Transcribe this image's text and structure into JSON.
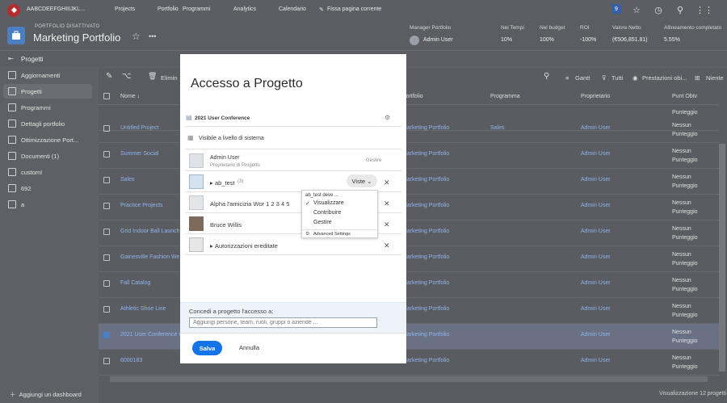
{
  "topbar": {
    "org": "AABCDEEFGHIIIJKL...",
    "nav": [
      "Projects",
      "Portfolio",
      "Programmi",
      "Analytics",
      "Calendario"
    ],
    "pin": "Fissa pagina corrente",
    "badge": "9"
  },
  "header": {
    "subtitle": "PORTFOLIO DISATTIVATO",
    "title": "Marketing Portfolio",
    "stats": [
      {
        "label": "Manager Portfolio",
        "value": "Admin User"
      },
      {
        "label": "Nei Tempi",
        "value": "10%"
      },
      {
        "label": "Nel budget",
        "value": "100%"
      },
      {
        "label": "ROI",
        "value": "-100%"
      },
      {
        "label": "Valore Netto",
        "value": "(€506,851.81)"
      },
      {
        "label": "Allineamento completato",
        "value": "5.55%"
      }
    ]
  },
  "breadcrumb": "Progetti",
  "sidebar": {
    "items": [
      "Aggiornamenti",
      "Progetti",
      "Programmi",
      "Dettagli portfolio",
      "Ottimizzazione Port...",
      "Documenti (1)",
      "customI",
      "692",
      "a"
    ],
    "footer": "Aggiungi un dashboard"
  },
  "toolbar": {
    "delete": "Elimin",
    "gantt": "Gantt",
    "filter": "Tutti",
    "view": "Prestazioni obi...",
    "group": "Niente"
  },
  "grid": {
    "headers": [
      "Nome ↓",
      "Portfolio",
      "Programma",
      "Proprietario",
      "Punt Obtv"
    ],
    "rows": [
      {
        "name": "",
        "portfolio": "",
        "program": "",
        "owner": "",
        "score": "Punteggio"
      },
      {
        "name": "Untitled Project",
        "portfolio": "Marketing Portfolio",
        "program": "Sales",
        "owner": "Admin User",
        "score": "Nessun Punteggio"
      },
      {
        "name": "Summer Social",
        "portfolio": "Marketing Portfolio",
        "program": "",
        "owner": "Admin User",
        "score": "Nessun Punteggio"
      },
      {
        "name": "Sales",
        "portfolio": "Marketing Portfolio",
        "program": "",
        "owner": "Admin User",
        "score": "Nessun Punteggio"
      },
      {
        "name": "Practice Projects",
        "portfolio": "Marketing Portfolio",
        "program": "",
        "owner": "Admin User",
        "score": "Nessun Punteggio"
      },
      {
        "name": "Grid Indoor Ball Launch",
        "portfolio": "Marketing Portfolio",
        "program": "",
        "owner": "Admin User",
        "score": "Nessun Punteggio"
      },
      {
        "name": "Gainesville Fashion We",
        "portfolio": "Marketing Portfolio",
        "program": "",
        "owner": "Admin User",
        "score": "Nessun Punteggio"
      },
      {
        "name": "Fall Catalog",
        "portfolio": "Marketing Portfolio",
        "program": "",
        "owner": "Admin User",
        "score": "Nessun Punteggio"
      },
      {
        "name": "Athletic Shoe Line",
        "portfolio": "Marketing Portfolio",
        "program": "",
        "owner": "Admin User",
        "score": "Nessun Punteggio"
      },
      {
        "name": "2021 User Conference C",
        "portfolio": "Marketing Portfolio",
        "program": "",
        "owner": "Admin User",
        "score": "Nessun Punteggio"
      },
      {
        "name": "6000183",
        "portfolio": "Marketing Portfolio",
        "program": "",
        "owner": "Admin User",
        "score": "Nessun Punteggio"
      }
    ],
    "footer": "Visualizzazione 12 progetti"
  },
  "modal": {
    "title": "Accesso a Progetto",
    "project": "2021 User Conference",
    "visibility": "Visibile a livello di sistema",
    "entries": [
      {
        "name": "Admin User",
        "role": "Proprietario di Progetto",
        "tag": "Gestire"
      },
      {
        "name": "ab_test",
        "count": "(3)",
        "access": "Viste"
      },
      {
        "name": "Alpha l'amicizia Wor 1 2 3 4 5"
      },
      {
        "name": "Bruce Willis"
      },
      {
        "name": "Autorizzazioni ereditate"
      }
    ],
    "dropdown": {
      "header": "ab_test deve ...",
      "options": [
        "Visualizzare",
        "Contribuire",
        "Gestire"
      ],
      "selected": "Visualizzare",
      "advanced": "Advanced Settings"
    },
    "grant_label": "Concedi a progetto l'accesso a:",
    "grant_placeholder": "Aggiungi persone, team, ruoli, gruppi o aziende ...",
    "save": "Salva",
    "cancel": "Annulla"
  }
}
